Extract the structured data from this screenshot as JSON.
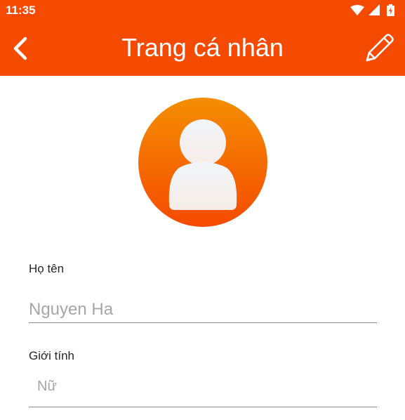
{
  "status_bar": {
    "time": "11:35"
  },
  "app_bar": {
    "title": "Trang cá nhân"
  },
  "profile": {
    "name_label": "Họ tên",
    "name_value": "Nguyen Ha",
    "gender_label": "Giới tính",
    "gender_value": "Nữ"
  },
  "colors": {
    "accent": "#f44a02",
    "avatar_top": "#f48e02",
    "avatar_bottom": "#f54a00"
  }
}
